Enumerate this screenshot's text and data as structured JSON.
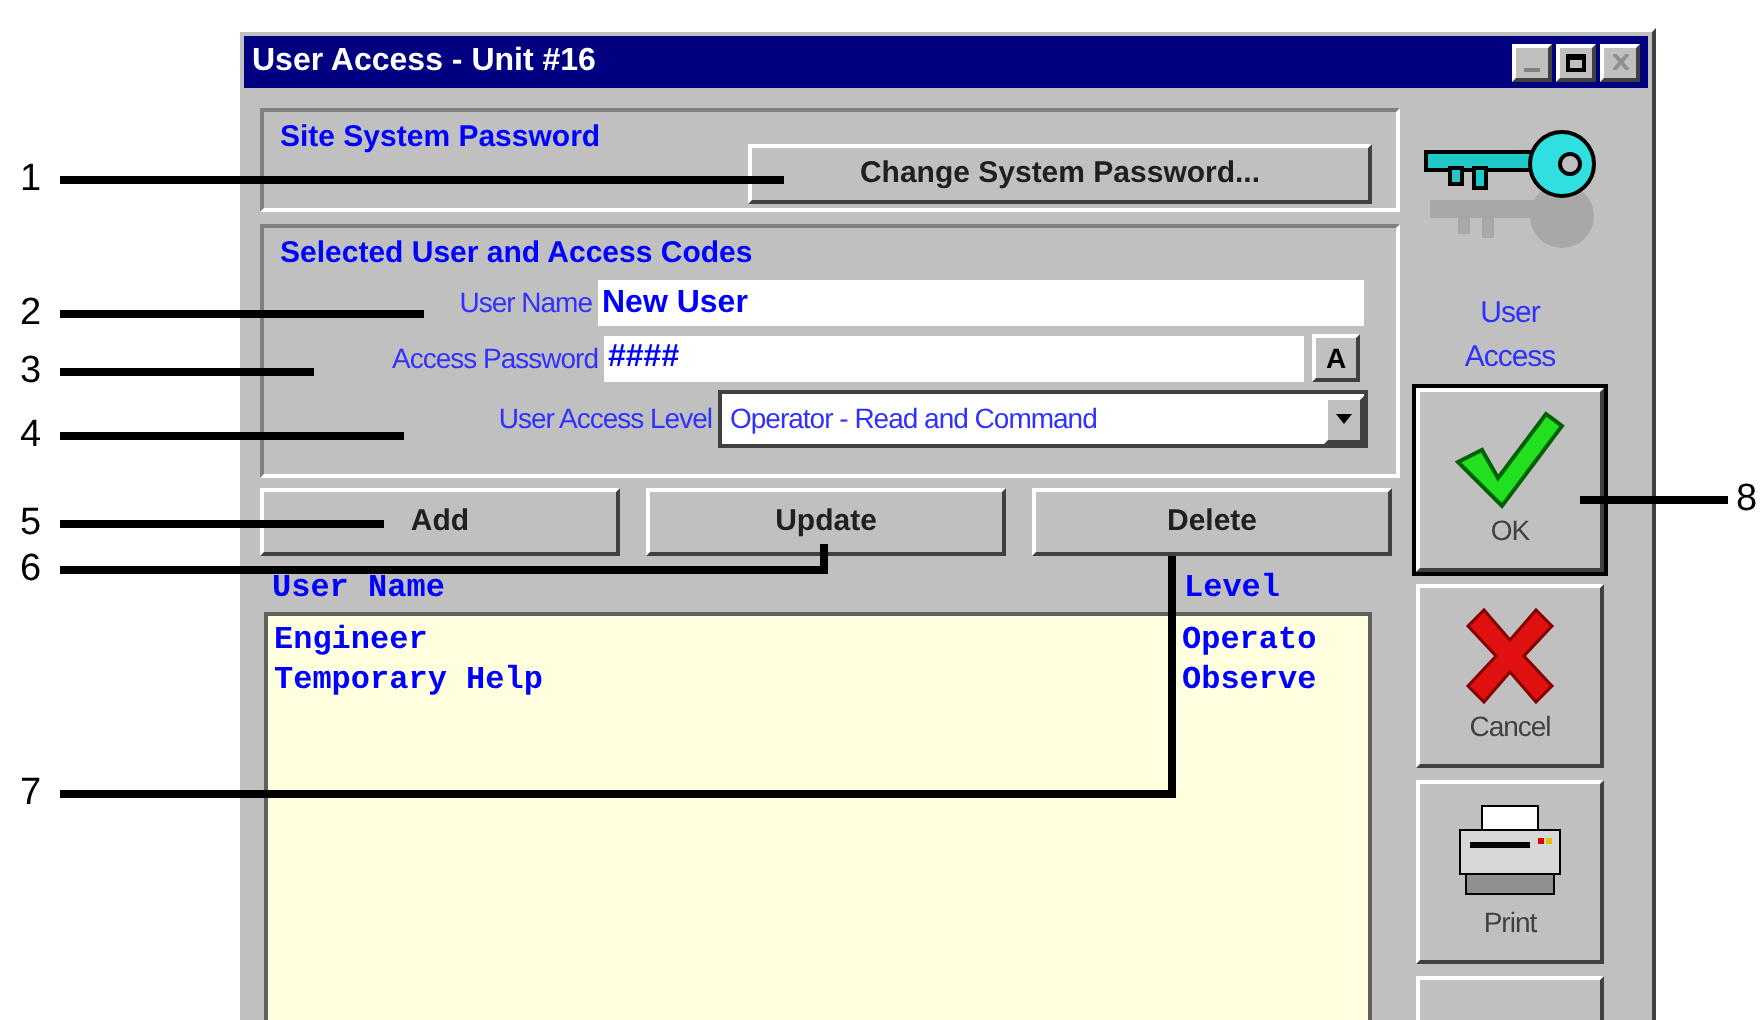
{
  "window": {
    "title": "User Access - Unit #16"
  },
  "site_password": {
    "heading": "Site System Password",
    "button": "Change System Password..."
  },
  "selected_user": {
    "heading": "Selected User and Access Codes",
    "fields": [
      {
        "kind": "text",
        "label": "User Name",
        "value": "New User"
      },
      {
        "kind": "password",
        "label": "Access Password",
        "value": "####",
        "button": "A"
      },
      {
        "kind": "select",
        "label": "User Access Level",
        "value": "Operator - Read and Command"
      }
    ]
  },
  "actions": [
    "Add",
    "Update",
    "Delete"
  ],
  "user_list": {
    "columns": [
      "User Name",
      "Level"
    ],
    "rows": [
      [
        "Engineer",
        "Operato"
      ],
      [
        "Temporary Help",
        "Observe"
      ]
    ]
  },
  "side": {
    "caption": "User Access",
    "buttons": [
      {
        "kind": "ok",
        "label": "OK"
      },
      {
        "kind": "cancel",
        "label": "Cancel"
      },
      {
        "kind": "print",
        "label": "Print"
      }
    ]
  },
  "callouts": [
    "1",
    "2",
    "3",
    "4",
    "5",
    "6",
    "7",
    "8"
  ]
}
